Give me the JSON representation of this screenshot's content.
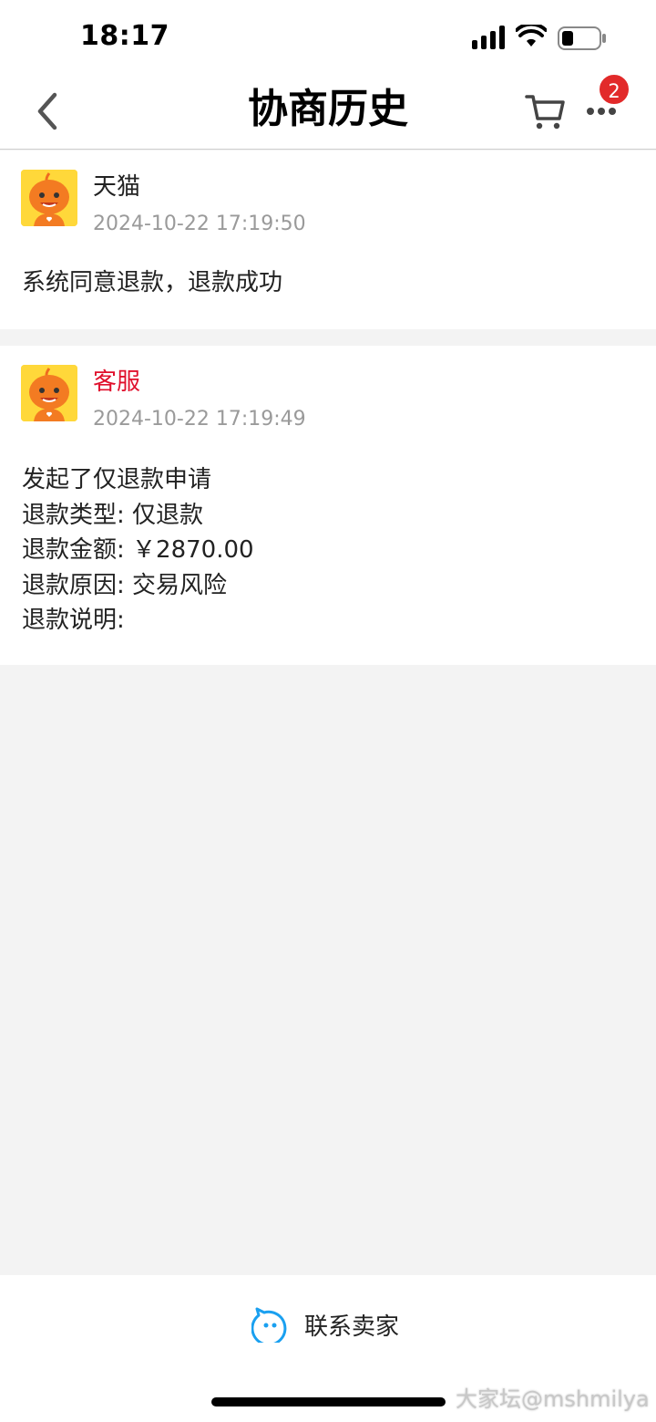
{
  "status_bar": {
    "time": "18:17"
  },
  "nav": {
    "title": "协商历史",
    "cart_badge": "2"
  },
  "history": [
    {
      "sender": "天猫",
      "timestamp": "2024-10-22 17:19:50",
      "lines": [
        "系统同意退款，退款成功"
      ]
    },
    {
      "sender": "客服",
      "timestamp": "2024-10-22 17:19:49",
      "lines": [
        "发起了仅退款申请",
        "退款类型: 仅退款",
        "退款金额: ￥2870.00",
        "退款原因: 交易风险",
        "退款说明:"
      ]
    }
  ],
  "bottom": {
    "contact_label": "联系卖家"
  },
  "watermark": "大家坛@mshmilya",
  "colors": {
    "accent_red": "#e0102c",
    "badge_red": "#e22a2a",
    "contact_blue": "#1aa0f0"
  }
}
